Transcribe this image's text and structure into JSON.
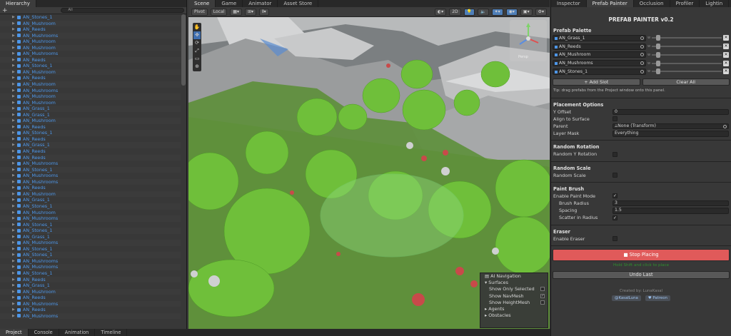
{
  "hierarchy": {
    "tab_label": "Hierarchy",
    "add_label": "+",
    "search_placeholder": "All",
    "items": [
      "AN_Stones_1",
      "AN_Mushroom",
      "AN_Reeds",
      "AN_Mushrooms",
      "AN_Mushroom",
      "AN_Mushroom",
      "AN_Mushrooms",
      "AN_Reeds",
      "AN_Stones_1",
      "AN_Mushroom",
      "AN_Reeds",
      "AN_Mushroom",
      "AN_Mushrooms",
      "AN_Mushroom",
      "AN_Mushroom",
      "AN_Grass_1",
      "AN_Grass_1",
      "AN_Mushroom",
      "AN_Reeds",
      "AN_Stones_1",
      "AN_Reeds",
      "AN_Grass_1",
      "AN_Reeds",
      "AN_Reeds",
      "AN_Mushrooms",
      "AN_Stones_1",
      "AN_Mushrooms",
      "AN_Mushrooms",
      "AN_Reeds",
      "AN_Mushroom",
      "AN_Grass_1",
      "AN_Stones_1",
      "AN_Mushroom",
      "AN_Mushrooms",
      "AN_Stones_1",
      "AN_Stones_1",
      "AN_Grass_1",
      "AN_Mushrooms",
      "AN_Stones_1",
      "AN_Stones_1",
      "AN_Mushrooms",
      "AN_Mushrooms",
      "AN_Stones_1",
      "AN_Reeds",
      "AN_Grass_1",
      "AN_Mushroom",
      "AN_Reeds",
      "AN_Mushrooms",
      "AN_Reeds",
      "AN_Mushrooms"
    ]
  },
  "scene": {
    "tabs": [
      "Scene",
      "Game",
      "Animator",
      "Asset Store"
    ],
    "pivot": "Pivot",
    "local": "Local",
    "mode_2d": "2D",
    "persp": "Persp",
    "tools": [
      "✋",
      "✥",
      "⟳",
      "⤢",
      "▭",
      "⊕"
    ],
    "nav": {
      "title": "AI Navigation",
      "surfaces": "Surfaces",
      "show_only_selected": "Show Only Selected",
      "show_navmesh": "Show NavMesh",
      "show_heightmesh": "Show HeightMesh",
      "agents": "Agents",
      "obstacles": "Obstacles"
    }
  },
  "inspector": {
    "tabs": [
      "Inspector",
      "Prefab Painter",
      "Occlusion",
      "Profiler",
      "Lightin"
    ],
    "title": "PREFAB PAINTER v0.2",
    "palette_header": "Prefab Palette",
    "slots": [
      {
        "name": "AN_Grass_1",
        "weight": 0.1
      },
      {
        "name": "AN_Reeds",
        "weight": 0.1
      },
      {
        "name": "AN_Mushroom",
        "weight": 0.1
      },
      {
        "name": "AN_Mushrooms",
        "weight": 0.1
      },
      {
        "name": "AN_Stones_1",
        "weight": 0.1
      }
    ],
    "add_slot": "+ Add Slot",
    "clear_all": "Clear All",
    "tip": "Tip: drag prefabs from the Project window onto this panel.",
    "placement_header": "Placement Options",
    "y_offset_label": "Y Offset",
    "y_offset_value": "0",
    "align_label": "Align to Surface",
    "parent_label": "Parent",
    "parent_value": "None (Transform)",
    "layer_mask_label": "Layer Mask",
    "layer_mask_value": "Everything",
    "rotation_header": "Random Rotation",
    "random_y_label": "Random Y Rotation",
    "scale_header": "Random Scale",
    "random_scale_label": "Random Scale",
    "paint_header": "Paint Brush",
    "enable_paint_label": "Enable Paint Mode",
    "brush_radius_label": "Brush Radius",
    "brush_radius_value": "3",
    "spacing_label": "Spacing",
    "spacing_value": "1.5",
    "scatter_label": "Scatter in Radius",
    "eraser_header": "Eraser",
    "enable_eraser_label": "Enable Eraser",
    "stop_placing": "■ Stop Placing",
    "placing_hint": "Hold Shift and click to place",
    "undo_last": "Undo Last",
    "credit": "Created by: LunaKasal",
    "link1": "@KasalLuna",
    "link2": "♥ Patreon"
  },
  "bottom_tabs": [
    "Project",
    "Console",
    "Animation",
    "Timeline"
  ],
  "colors": {
    "accent": "#4d96e8",
    "stop_button": "#e05a5a",
    "grass": "#5fa832",
    "navmesh": "#7ed47e"
  }
}
